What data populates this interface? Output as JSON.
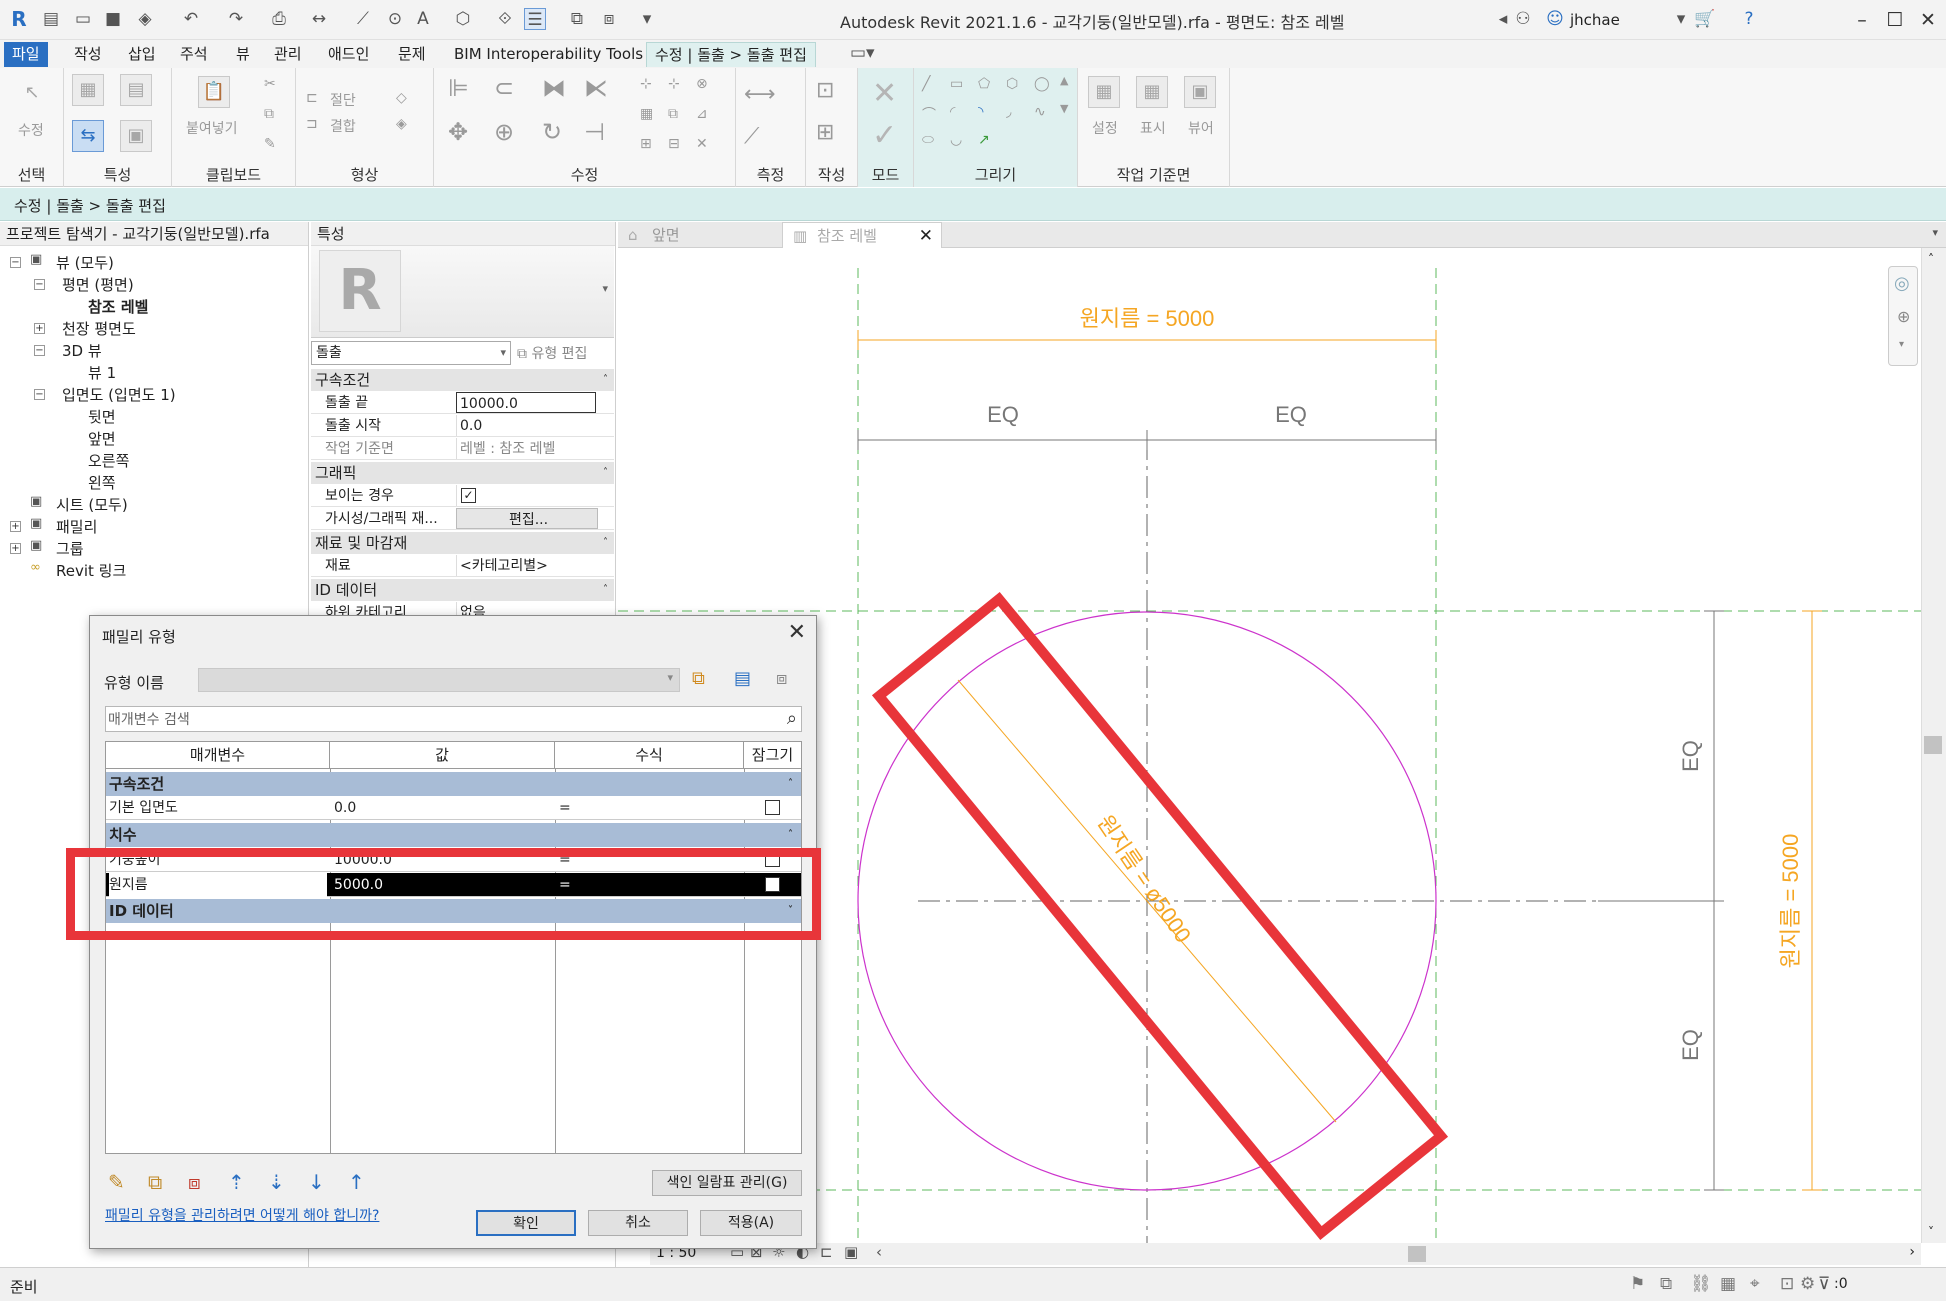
{
  "title_bar": {
    "title": "Autodesk Revit 2021.1.6 - 교각기둥(일반모델).rfa - 평면도: 참조 레벨",
    "user": "jhchae"
  },
  "ribbon_tabs": [
    "파일",
    "작성",
    "삽입",
    "주석",
    "뷰",
    "관리",
    "애드인",
    "문제",
    "BIM Interoperability Tools",
    "수정 | 돌출 > 돌출 편집"
  ],
  "ribbon_panels": {
    "select": "선택",
    "properties": "특성",
    "clipboard": "클립보드",
    "geometry": "형상",
    "modify": "수정",
    "measure": "측정",
    "create": "작성",
    "mode": "모드",
    "draw": "그리기",
    "work_plane": "작업 기준면",
    "modify_label": "수정",
    "paste": "붙여넣기",
    "cut": "절단",
    "join": "결합",
    "set": "설정",
    "show": "표시",
    "viewer": "뷰어"
  },
  "context_bar": "수정 | 돌출 > 돌출 편집",
  "project_browser": {
    "header": "프로젝트 탐색기 - 교각기둥(일반모델).rfa",
    "items": [
      {
        "label": "뷰 (모두)",
        "level": 0,
        "toggle": "−"
      },
      {
        "label": "평면 (평면)",
        "level": 1,
        "toggle": "−"
      },
      {
        "label": "참조 레벨",
        "level": 2,
        "toggle": "",
        "bold": true
      },
      {
        "label": "천장 평면도",
        "level": 1,
        "toggle": "+"
      },
      {
        "label": "3D 뷰",
        "level": 1,
        "toggle": "−"
      },
      {
        "label": "뷰 1",
        "level": 2,
        "toggle": ""
      },
      {
        "label": "입면도 (입면도 1)",
        "level": 1,
        "toggle": "−"
      },
      {
        "label": "뒷면",
        "level": 2,
        "toggle": ""
      },
      {
        "label": "앞면",
        "level": 2,
        "toggle": ""
      },
      {
        "label": "오른쪽",
        "level": 2,
        "toggle": ""
      },
      {
        "label": "왼쪽",
        "level": 2,
        "toggle": ""
      },
      {
        "label": "시트 (모두)",
        "level": 0,
        "toggle": ""
      },
      {
        "label": "패밀리",
        "level": 0,
        "toggle": "+"
      },
      {
        "label": "그룹",
        "level": 0,
        "toggle": "+"
      },
      {
        "label": "Revit 링크",
        "level": 0,
        "toggle": ""
      }
    ]
  },
  "properties": {
    "header": "특성",
    "type_selector": "돌출",
    "edit_type": "유형 편집",
    "sections": {
      "constraints": "구속조건",
      "graphics": "그래픽",
      "materials": "재료 및 마감재",
      "id_data": "ID 데이터"
    },
    "rows": {
      "extrusion_end_label": "돌출 끝",
      "extrusion_end_value": "10000.0",
      "extrusion_start_label": "돌출 시작",
      "extrusion_start_value": "0.0",
      "work_plane_label": "작업 기준면",
      "work_plane_value": "레벨 : 참조 레벨",
      "visible_label": "보이는 경우",
      "vg_label": "가시성/그래픽 재...",
      "vg_button": "편집...",
      "material_label": "재료",
      "material_value": "<카테고리별>",
      "id_label": "하위 카테고리",
      "id_value": "없음"
    }
  },
  "view_tabs": [
    "앞면",
    "참조 레벨"
  ],
  "canvas": {
    "dim_top": "원지름 = 5000",
    "eq_left": "EQ",
    "eq_right": "EQ",
    "eq_v_top": "EQ",
    "eq_v_bottom": "EQ",
    "dim_right": "원지름 = 5000",
    "dim_diag": "원지름 = ø5000",
    "scale": "1 : 50",
    "colors": {
      "dim": "#f5a623",
      "circle": "#cc33cc",
      "ref": "#55bb55",
      "highlight": "#e8353a"
    }
  },
  "status_bar": {
    "text": "준비",
    "filter_count": ":0"
  },
  "dialog": {
    "title": "패밀리 유형",
    "type_name_label": "유형 이름",
    "search_placeholder": "매개변수 검색",
    "columns": [
      "매개변수",
      "값",
      "수식",
      "잠그기"
    ],
    "sections": {
      "constraints": "구속조건",
      "dimensions": "치수",
      "id_data": "ID 데이터"
    },
    "rows": [
      {
        "param": "기본 입면도",
        "value": "0.0",
        "formula": "="
      },
      {
        "param": "기둥높이",
        "value": "10000.0",
        "formula": "="
      },
      {
        "param": "원지름",
        "value": "5000.0",
        "formula": "="
      }
    ],
    "lookup_button": "색인 일람표 관리(G)",
    "help_link": "패밀리 유형을 관리하려면 어떻게 해야 합니까?",
    "ok": "확인",
    "cancel": "취소",
    "apply": "적용(A)"
  }
}
